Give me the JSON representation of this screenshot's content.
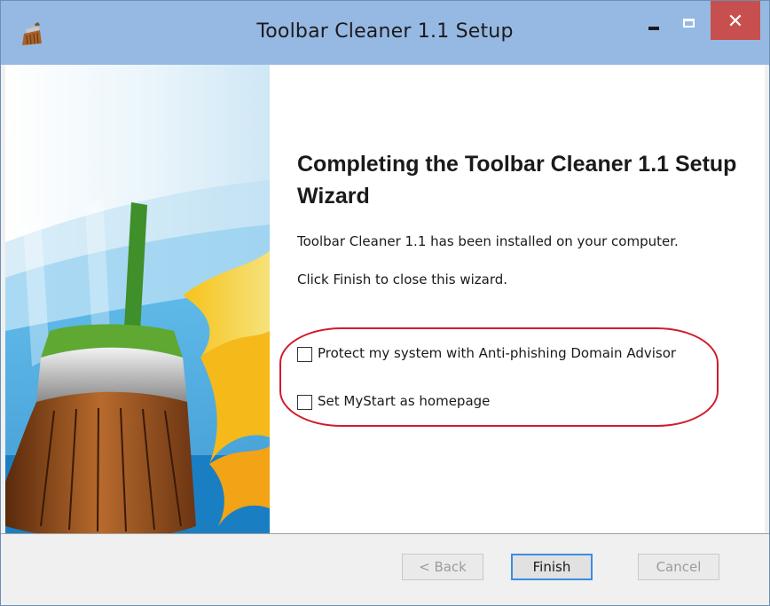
{
  "window": {
    "title": "Toolbar Cleaner 1.1 Setup",
    "minimize_glyph": "",
    "maximize_glyph": "",
    "close_glyph": "✕"
  },
  "wizard": {
    "heading": "Completing the Toolbar Cleaner 1.1 Setup Wizard",
    "installed_text": "Toolbar Cleaner 1.1 has been installed on your computer.",
    "instruction_text": "Click Finish to close this wizard."
  },
  "options": [
    {
      "label": "Protect my system with Anti-phishing Domain Advisor",
      "checked": false
    },
    {
      "label": "Set MyStart as homepage",
      "checked": false
    }
  ],
  "buttons": {
    "back_label": "< Back",
    "finish_label": "Finish",
    "cancel_label": "Cancel"
  },
  "icons": {
    "app": "broom-app-icon",
    "side_image": "broom-with-flames-image"
  },
  "colors": {
    "titlebar": "#96b9e4",
    "close_button": "#c7504e",
    "highlight_outline": "#d01c2b",
    "finish_focus": "#3c8de0"
  }
}
